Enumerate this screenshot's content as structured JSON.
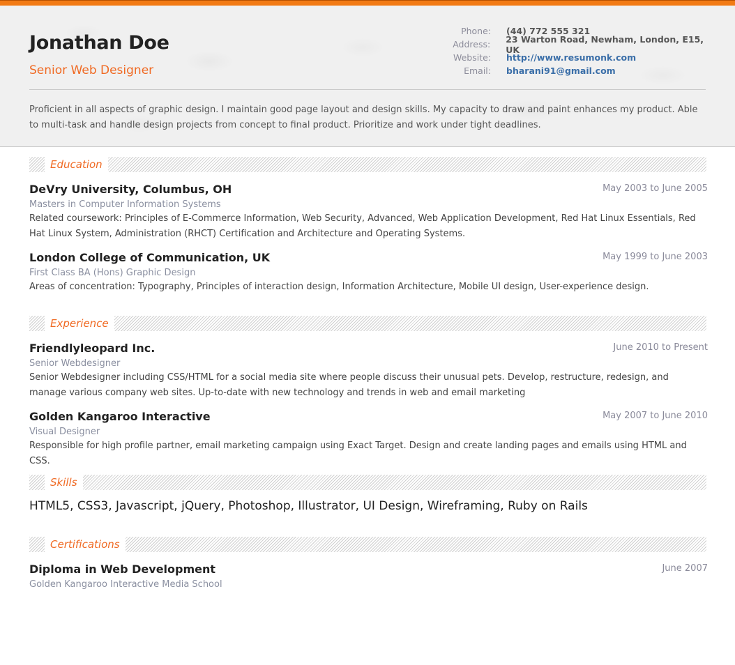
{
  "header": {
    "name": "Jonathan Doe",
    "title": "Senior Web Designer",
    "contact": [
      {
        "label": "Phone:",
        "value": "(44) 772 555 321",
        "link": false
      },
      {
        "label": "Address:",
        "value": "23 Warton Road, Newham, London, E15, UK",
        "link": false
      },
      {
        "label": "Website:",
        "value": "http://www.resumonk.com",
        "link": true
      },
      {
        "label": "Email:",
        "value": "bharani91@gmail.com",
        "link": true
      }
    ],
    "summary": "Proficient in all aspects of graphic design. I maintain good page layout and design skills. My capacity to draw and paint enhances my product. Able to multi-task and handle design projects from concept to final product. Prioritize and work under tight deadlines."
  },
  "colors": {
    "accent": "#f06a23",
    "topbar": "#f27a14",
    "link": "#3a6ea8"
  },
  "sections": {
    "education": {
      "title": "Education",
      "items": [
        {
          "title": "DeVry University, Columbus, OH",
          "date": "May 2003 to June 2005",
          "subtitle": "Masters in Computer Information Systems",
          "description": "Related coursework: Principles of E-Commerce Information, Web Security, Advanced, Web Application Development, Red Hat Linux Essentials, Red Hat Linux System, Administration (RHCT) Certification and Architecture and Operating Systems."
        },
        {
          "title": "London College of Communication, UK",
          "date": "May 1999 to June 2003",
          "subtitle": "First Class BA (Hons) Graphic Design",
          "description": "Areas of concentration: Typography, Principles of interaction design, Information Architecture, Mobile UI design, User-experience design."
        }
      ]
    },
    "experience": {
      "title": "Experience",
      "items": [
        {
          "title": "Friendlyleopard Inc.",
          "date": "June 2010 to Present",
          "subtitle": "Senior Webdesigner",
          "description": "Senior Webdesigner including CSS/HTML for a social media site where people discuss their unusual pets. Develop, restructure, redesign, and manage various company web sites. Up-to-date with new technology and trends in web and email marketing"
        },
        {
          "title": "Golden Kangaroo Interactive",
          "date": "May 2007 to June 2010",
          "subtitle": "Visual Designer",
          "description": "Responsible for high profile partner, email marketing campaign using Exact Target. Design and create landing pages and emails using HTML and CSS."
        }
      ]
    },
    "skills": {
      "title": "Skills",
      "text": "HTML5, CSS3, Javascript, jQuery, Photoshop, Illustrator, UI Design, Wireframing, Ruby on Rails"
    },
    "certifications": {
      "title": "Certifications",
      "items": [
        {
          "title": "Diploma in Web Development",
          "date": "June 2007",
          "subtitle": "Golden Kangaroo Interactive Media School"
        }
      ]
    }
  }
}
